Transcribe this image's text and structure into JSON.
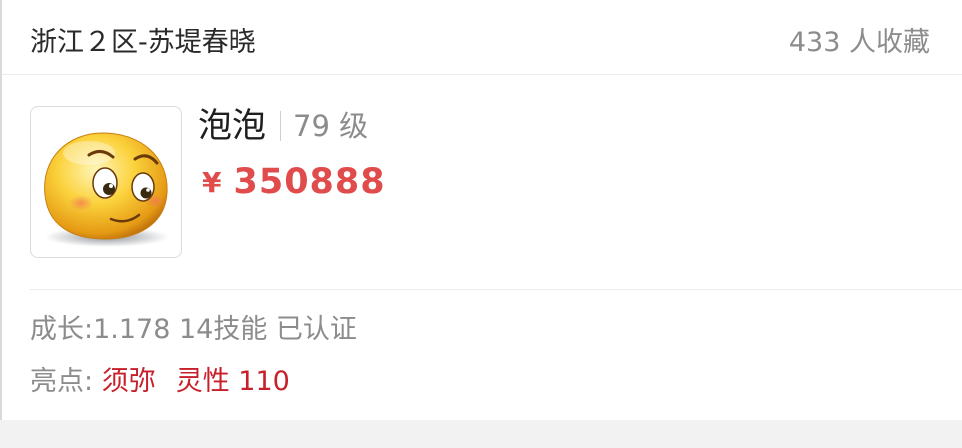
{
  "listing": {
    "server": "浙江２区-苏堤春晓",
    "favorites": "433 人收藏",
    "pet": {
      "icon": "smiley-face-icon",
      "name": "泡泡",
      "level": "79 级"
    },
    "price": {
      "currency": "¥",
      "amount": "350888",
      "color": "#e04b4b"
    },
    "stats": "成长:1.178 14技能 已认证",
    "highlights": {
      "label": "亮点:",
      "items": [
        "须弥",
        "灵性 110"
      ],
      "color": "#c8202b"
    }
  }
}
